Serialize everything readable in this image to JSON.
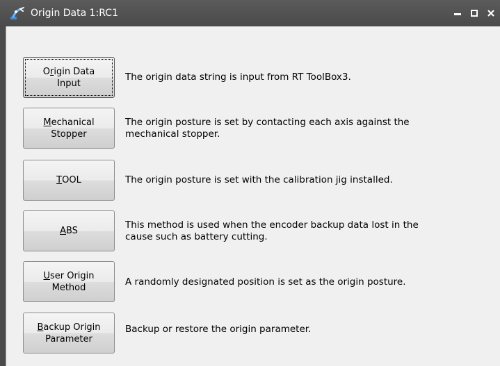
{
  "window": {
    "title": "Origin Data 1:RC1",
    "controls": {
      "minimize": "minimize",
      "maximize": "maximize",
      "close": "close"
    }
  },
  "methods": [
    {
      "button_line1_pre": "O",
      "button_line1_mnemonic": "r",
      "button_line1_post": "igin Data",
      "button_line2": "Input",
      "desc_line1": "The origin data string is input from RT ToolBox3.",
      "desc_line2": ""
    },
    {
      "button_line1_pre": "",
      "button_line1_mnemonic": "M",
      "button_line1_post": "echanical",
      "button_line2": "Stopper",
      "desc_line1": "The origin posture is set by contacting each axis against the",
      "desc_line2": "mechanical stopper."
    },
    {
      "button_line1_pre": "",
      "button_line1_mnemonic": "T",
      "button_line1_post": "OOL",
      "button_line2": "",
      "desc_line1": "The origin posture is set with the calibration jig installed.",
      "desc_line2": ""
    },
    {
      "button_line1_pre": "",
      "button_line1_mnemonic": "A",
      "button_line1_post": "BS",
      "button_line2": "",
      "desc_line1": "This method is used when the encoder backup data lost in the",
      "desc_line2": "cause such as battery cutting."
    },
    {
      "button_line1_pre": "",
      "button_line1_mnemonic": "U",
      "button_line1_post": "ser Origin",
      "button_line2": "Method",
      "desc_line1": "A randomly designated position is set as the origin posture.",
      "desc_line2": ""
    },
    {
      "button_line1_pre": "",
      "button_line1_mnemonic": "B",
      "button_line1_post": "ackup Origin",
      "button_line2": "Parameter",
      "desc_line1": "Backup or restore the origin parameter.",
      "desc_line2": ""
    }
  ]
}
